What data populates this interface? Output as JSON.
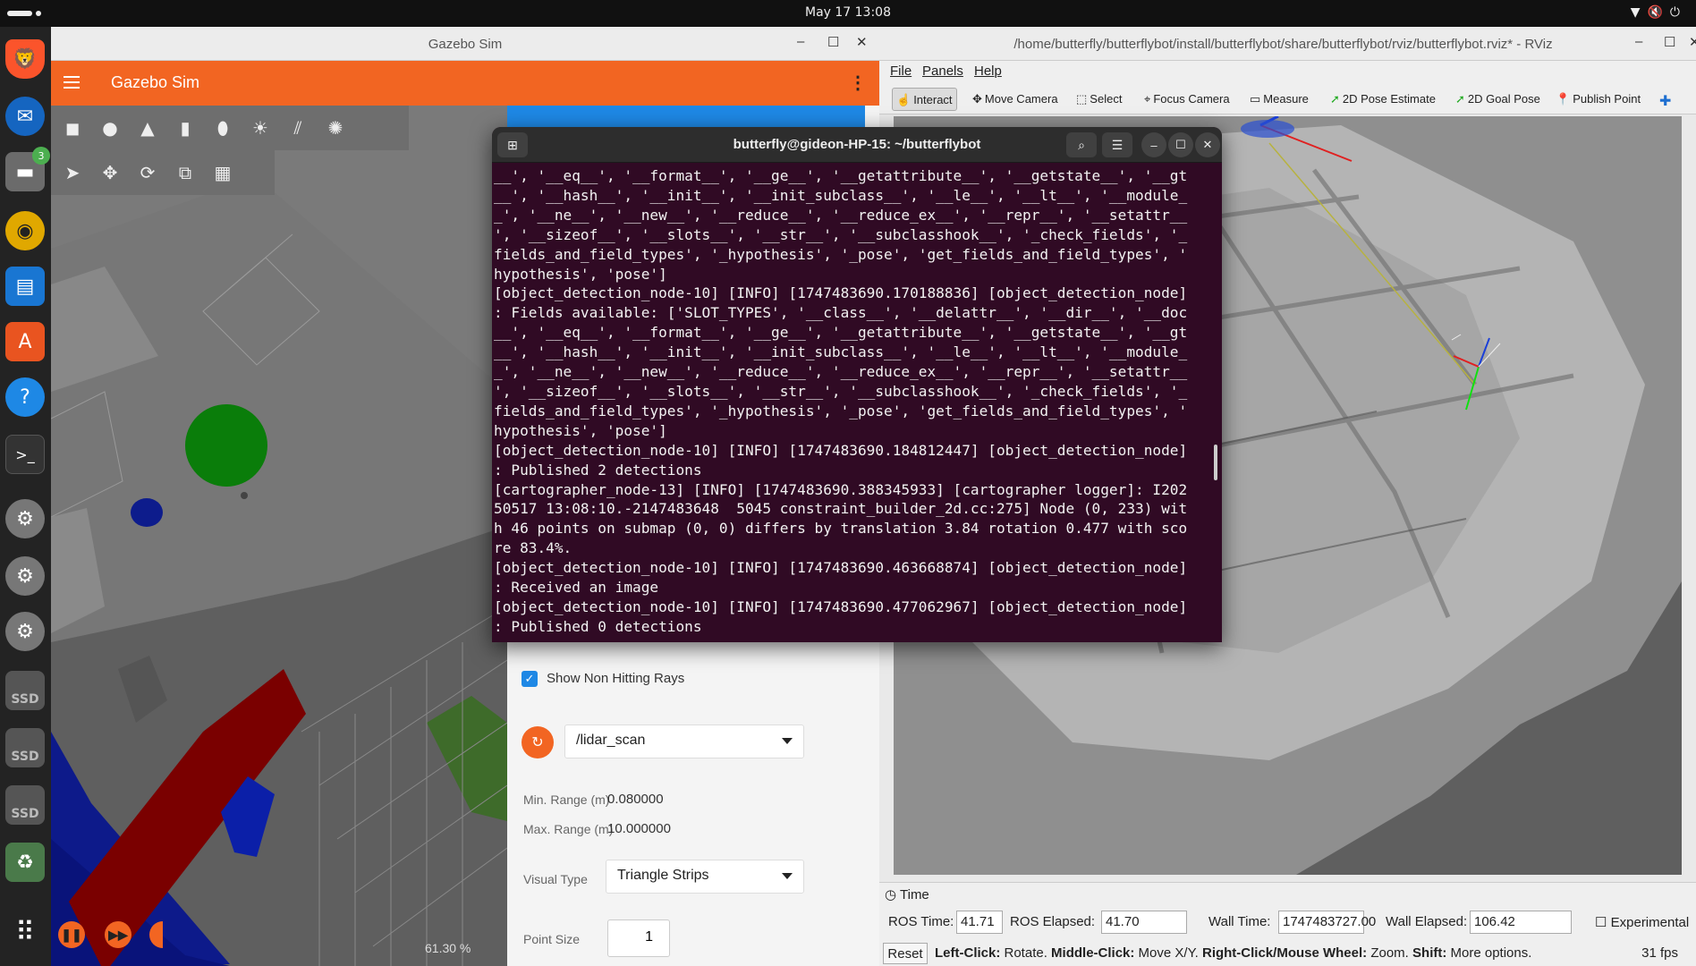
{
  "topbar": {
    "clock": "May 17  13:08"
  },
  "dock": {
    "files_badge": "3",
    "ssd_label": "SSD"
  },
  "gazebo": {
    "window_title": "Gazebo Sim",
    "header_title": "Gazebo Sim",
    "zoom": "61.30 %",
    "panel": {
      "show_non_hitting_rays": "Show Non Hitting Rays",
      "topic": "/lidar_scan",
      "min_range_label": "Min. Range (m)",
      "min_range_value": "0.080000",
      "max_range_label": "Max. Range (m)",
      "max_range_value": "10.000000",
      "visual_type_label": "Visual Type",
      "visual_type_value": "Triangle Strips",
      "point_size_label": "Point Size",
      "point_size_value": "1"
    }
  },
  "terminal": {
    "title": "butterfly@gideon-HP-15: ~/butterflybot",
    "lines": [
      "__', '__eq__', '__format__', '__ge__', '__getattribute__', '__getstate__', '__gt",
      "__', '__hash__', '__init__', '__init_subclass__', '__le__', '__lt__', '__module_",
      "_', '__ne__', '__new__', '__reduce__', '__reduce_ex__', '__repr__', '__setattr__",
      "', '__sizeof__', '__slots__', '__str__', '__subclasshook__', '_check_fields', '_",
      "fields_and_field_types', '_hypothesis', '_pose', 'get_fields_and_field_types', '",
      "hypothesis', 'pose']",
      "[object_detection_node-10] [INFO] [1747483690.170188836] [object_detection_node]",
      ": Fields available: ['SLOT_TYPES', '__class__', '__delattr__', '__dir__', '__doc",
      "__', '__eq__', '__format__', '__ge__', '__getattribute__', '__getstate__', '__gt",
      "__', '__hash__', '__init__', '__init_subclass__', '__le__', '__lt__', '__module_",
      "_', '__ne__', '__new__', '__reduce__', '__reduce_ex__', '__repr__', '__setattr__",
      "', '__sizeof__', '__slots__', '__str__', '__subclasshook__', '_check_fields', '_",
      "fields_and_field_types', '_hypothesis', '_pose', 'get_fields_and_field_types', '",
      "hypothesis', 'pose']",
      "[object_detection_node-10] [INFO] [1747483690.184812447] [object_detection_node]",
      ": Published 2 detections",
      "[cartographer_node-13] [INFO] [1747483690.388345933] [cartographer logger]: I202",
      "50517 13:08:10.-2147483648  5045 constraint_builder_2d.cc:275] Node (0, 233) wit",
      "h 46 points on submap (0, 0) differs by translation 3.84 rotation 0.477 with sco",
      "re 83.4%.",
      "[object_detection_node-10] [INFO] [1747483690.463668874] [object_detection_node]",
      ": Received an image",
      "[object_detection_node-10] [INFO] [1747483690.477062967] [object_detection_node]",
      ": Published 0 detections"
    ]
  },
  "rviz": {
    "window_title": "/home/butterfly/butterflybot/install/butterflybot/share/butterflybot/rviz/butterflybot.rviz* - RViz",
    "menu": {
      "file": "File",
      "panels": "Panels",
      "help": "Help"
    },
    "tools": {
      "interact": "Interact",
      "move_camera": "Move Camera",
      "select": "Select",
      "focus_camera": "Focus Camera",
      "measure": "Measure",
      "pose_estimate": "2D Pose Estimate",
      "goal_pose": "2D Goal Pose",
      "publish_point": "Publish Point"
    },
    "time": {
      "title": "Time",
      "ros_time_label": "ROS Time:",
      "ros_time": "41.71",
      "ros_elapsed_label": "ROS Elapsed:",
      "ros_elapsed": "41.70",
      "wall_time_label": "Wall Time:",
      "wall_time": "1747483727.00",
      "wall_elapsed_label": "Wall Elapsed:",
      "wall_elapsed": "106.42",
      "experimental": "Experimental"
    },
    "status": {
      "reset": "Reset",
      "left_click_b": "Left-Click:",
      "left_click": " Rotate. ",
      "middle_click_b": "Middle-Click:",
      "middle_click": " Move X/Y. ",
      "right_click_b": "Right-Click/Mouse Wheel:",
      "right_click": " Zoom. ",
      "shift_b": "Shift:",
      "shift": " More options.",
      "fps": "31 fps"
    }
  }
}
